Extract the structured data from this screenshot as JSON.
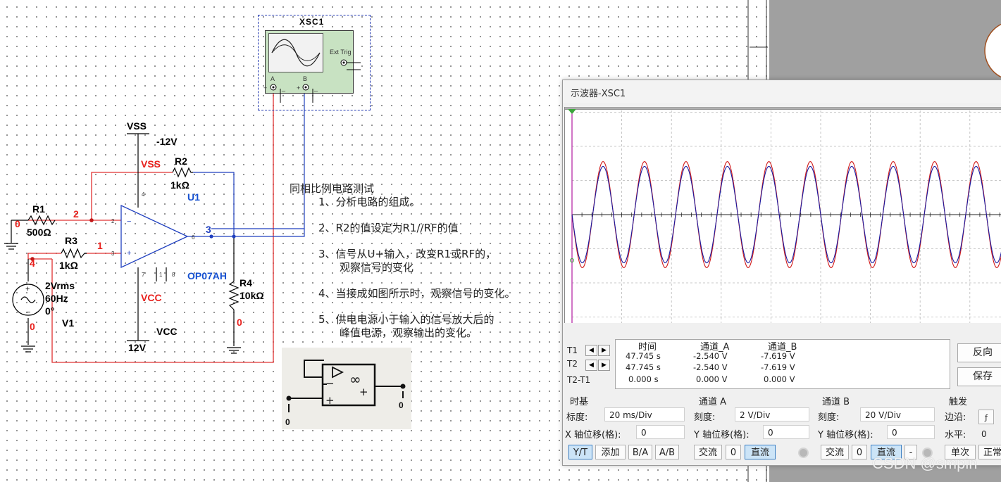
{
  "schematic": {
    "oscilloscope_label": "XSC1",
    "scope_icon": {
      "ext_trig": "Ext Trig",
      "channel_a": "A",
      "channel_b": "B",
      "plus": "+",
      "minus": "_"
    },
    "vss": {
      "name": "VSS",
      "value": "-12V",
      "net": "VSS"
    },
    "vcc": {
      "name": "VCC",
      "value": "12V",
      "net": "VCC"
    },
    "r1": {
      "name": "R1",
      "value": "500Ω"
    },
    "r2": {
      "name": "R2",
      "value": "1kΩ"
    },
    "r3": {
      "name": "R3",
      "value": "1kΩ"
    },
    "r4": {
      "name": "R4",
      "value": "10kΩ"
    },
    "u1": {
      "name": "U1",
      "model": "OP07AH"
    },
    "v1": {
      "name": "V1",
      "amplitude": "2Vrms",
      "frequency": "60Hz",
      "phase": "0°"
    },
    "nodes": [
      "0",
      "2",
      "1",
      "4",
      "0",
      "3",
      "0"
    ],
    "pins": [
      "4",
      "2",
      "3",
      "6",
      "7",
      "1",
      "8"
    ],
    "notes": [
      "同相比例电路测试",
      "1、分析电路的组成。",
      "2、R2的值设定为R1//RF的值",
      "3、信号从U+输入，改变R1或RF的，",
      "观察信号的变化",
      "4、当接成如图所示时，观察信号的变化。",
      "5、供电电源小于输入的信号放大后的",
      "峰值电源，观察输出的变化。"
    ],
    "photo_marks": {
      "inf": "∞",
      "plus": "+",
      "minus": "−",
      "zero": "0"
    }
  },
  "oscilloscope_window": {
    "title": "示波器-XSC1",
    "readout": {
      "headers": [
        "时间",
        "通道_A",
        "通道_B"
      ],
      "rows": [
        {
          "label": "T1",
          "time": "47.745 s",
          "a": "-2.540 V",
          "b": "-7.619 V"
        },
        {
          "label": "T2",
          "time": "47.745 s",
          "a": "-2.540 V",
          "b": "-7.619 V"
        },
        {
          "label": "T2-T1",
          "time": "0.000 s",
          "a": "0.000 V",
          "b": "0.000 V"
        }
      ],
      "arrow_left": "◀",
      "arrow_right": "▶"
    },
    "buttons": {
      "reverse": "反向",
      "save": "保存"
    },
    "timebase": {
      "title": "时基",
      "scale_label": "标度:",
      "scale_value": "20 ms/Div",
      "x_offset_label": "X 轴位移(格):",
      "x_offset_value": "0",
      "modes": [
        "Y/T",
        "添加",
        "B/A",
        "A/B"
      ],
      "active_mode": "Y/T"
    },
    "channel_a": {
      "title": "通道 A",
      "scale_label": "刻度:",
      "scale_value": "2  V/Div",
      "y_offset_label": "Y 轴位移(格):",
      "y_offset_value": "0",
      "coupling": [
        "交流",
        "0",
        "直流"
      ],
      "active_coupling": "直流"
    },
    "channel_b": {
      "title": "通道 B",
      "scale_label": "刻度:",
      "scale_value": "20  V/Div",
      "y_offset_label": "Y 轴位移(格):",
      "y_offset_value": "0",
      "coupling": [
        "交流",
        "0",
        "直流",
        "-"
      ],
      "active_coupling": "直流"
    },
    "trigger": {
      "title": "触发",
      "edge_label": "边沿:",
      "edge_value": "ƒ",
      "level_label": "水平:",
      "level_value": "0",
      "single": "单次",
      "normal": "正常"
    }
  },
  "waveforms": {
    "channel_a_color": "#1a1aa0",
    "channel_b_color": "#d01818",
    "channel_a_amplitude_v": 2.828,
    "channel_b_amplitude_v": 31.1,
    "frequency_hz": 60,
    "time_per_div_ms": 20,
    "channel_a_v_per_div": 2,
    "channel_b_v_per_div": 20,
    "cycles_visible": 10
  },
  "watermark": "CSDN @smpin"
}
